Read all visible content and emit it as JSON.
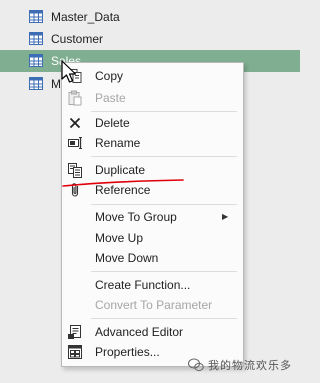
{
  "queries": [
    {
      "label": "Master_Data",
      "selected": false
    },
    {
      "label": "Customer",
      "selected": false
    },
    {
      "label": "Sales",
      "selected": true
    },
    {
      "label": "M",
      "selected": false
    }
  ],
  "menu": {
    "items": {
      "copy": {
        "label": "Copy",
        "enabled": true
      },
      "paste": {
        "label": "Paste",
        "enabled": false
      },
      "delete": {
        "label": "Delete",
        "enabled": true
      },
      "rename": {
        "label": "Rename",
        "enabled": true
      },
      "duplicate": {
        "label": "Duplicate",
        "enabled": true
      },
      "reference": {
        "label": "Reference",
        "enabled": true
      },
      "move_to_group": {
        "label": "Move To Group",
        "enabled": true,
        "submenu_arrow": "▶"
      },
      "move_up": {
        "label": "Move Up",
        "enabled": true
      },
      "move_down": {
        "label": "Move Down",
        "enabled": true
      },
      "create_function": {
        "label": "Create Function...",
        "enabled": true
      },
      "convert_to_parameter": {
        "label": "Convert To Parameter",
        "enabled": false
      },
      "advanced_editor": {
        "label": "Advanced Editor",
        "enabled": true
      },
      "properties": {
        "label": "Properties...",
        "enabled": true
      }
    }
  },
  "annotation": {
    "color": "#e0000b"
  },
  "watermark": {
    "text": "我的物流欢乐多"
  },
  "colors": {
    "selected_row": "#7fae90",
    "table_icon": "#3d6db5",
    "annotation": "#e0000b"
  }
}
